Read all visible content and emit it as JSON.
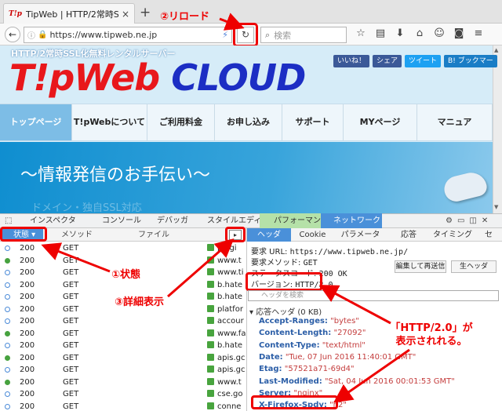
{
  "browser": {
    "tab_title": "TipWeb | HTTP/2常時SSL...",
    "favicon_text": "T!p",
    "url": "https://www.tipweb.ne.jp",
    "search_placeholder": "検索",
    "tab_close": "×",
    "new_tab": "+",
    "icons": [
      "back-icon",
      "info-icon",
      "lock-icon",
      "reload-icon",
      "search-icon",
      "star-icon",
      "reader-icon",
      "download-icon",
      "home-icon",
      "sync-icon",
      "pocket-icon",
      "menu-icon"
    ]
  },
  "site": {
    "tagline": "HTTP/2常時SSL化無料レンタルサーバー",
    "logo_a": "T!pWeb",
    "logo_b": "CLOUD",
    "social": [
      {
        "label": "いいね！",
        "color": "#3b5998"
      },
      {
        "label": "シェア",
        "color": "#3b5998"
      },
      {
        "label": "ツイート",
        "color": "#1da1f2"
      },
      {
        "label": "B! ブックマー",
        "color": "#1a7dc6"
      }
    ],
    "nav": [
      "トップページ",
      "T!pWebについて",
      "ご利用料金",
      "お申し込み",
      "サポート",
      "MYページ",
      "マニュア"
    ],
    "banner": "〜情報発信のお手伝い〜",
    "banner_sub": "ドメイン・独自SSL対応"
  },
  "devtools": {
    "tabs": [
      "インスペクタ",
      "コンソール",
      "デバッガ",
      "スタイルエディタ",
      "パフォーマンス",
      "ネットワーク"
    ],
    "columns": {
      "status": "状態",
      "method": "メソッド",
      "file": "ファイル"
    },
    "requests": [
      {
        "status": "200",
        "method": "GET",
        "file": "plugi",
        "cached": true
      },
      {
        "status": "200",
        "method": "GET",
        "file": "www.t",
        "cached": false
      },
      {
        "status": "200",
        "method": "GET",
        "file": "www.ti",
        "cached": true
      },
      {
        "status": "200",
        "method": "GET",
        "file": "b.hate",
        "cached": true
      },
      {
        "status": "200",
        "method": "GET",
        "file": "b.hate",
        "cached": true
      },
      {
        "status": "200",
        "method": "GET",
        "file": "platfor",
        "cached": true
      },
      {
        "status": "200",
        "method": "GET",
        "file": "accour",
        "cached": true
      },
      {
        "status": "200",
        "method": "GET",
        "file": "www.fa",
        "cached": false
      },
      {
        "status": "200",
        "method": "GET",
        "file": "b.hate",
        "cached": true
      },
      {
        "status": "200",
        "method": "GET",
        "file": "apis.gc",
        "cached": false
      },
      {
        "status": "200",
        "method": "GET",
        "file": "apis.gc",
        "cached": true
      },
      {
        "status": "200",
        "method": "GET",
        "file": "www.t",
        "cached": false
      },
      {
        "status": "200",
        "method": "GET",
        "file": "cse.go",
        "cached": true
      },
      {
        "status": "200",
        "method": "GET",
        "file": "conne",
        "cached": true
      }
    ],
    "detail_tabs": [
      "ヘッダ",
      "Cookie",
      "パラメータ",
      "応答",
      "タイミング",
      "セ"
    ],
    "request_url_label": "要求 URL:",
    "request_url": "https://www.tipweb.ne.jp/",
    "request_method_label": "要求メソッド:",
    "request_method": "GET",
    "status_code_label": "ステータスコード:",
    "status_code": "200 OK",
    "edit_resend": "編集して再送信",
    "raw_headers": "生ヘッダ",
    "version_label": "バージョン:",
    "version": "HTTP/2.0",
    "filter_placeholder": "ヘッダを検索",
    "response_headers": "応答ヘッダ (0 KB)",
    "headers": [
      {
        "k": "Accept-Ranges:",
        "v": "\"bytes\""
      },
      {
        "k": "Content-Length:",
        "v": "\"27092\""
      },
      {
        "k": "Content-Type:",
        "v": "\"text/html\""
      },
      {
        "k": "Date:",
        "v": "\"Tue, 07 Jun 2016 11:40:01 GMT\""
      },
      {
        "k": "Etag:",
        "v": "\"57521a71-69d4\""
      },
      {
        "k": "Last-Modified:",
        "v": "\"Sat, 04 Jun 2016 00:01:53 GMT\""
      },
      {
        "k": "Server:",
        "v": "\"nginx\""
      },
      {
        "k": "X-Firefox-Spdy:",
        "v": "\"h2\""
      }
    ]
  },
  "annotations": {
    "reload": "②リロード",
    "status": "①状態",
    "detail": "③詳細表示",
    "http2": "「HTTP/2.0」が\n表示されれる。"
  }
}
